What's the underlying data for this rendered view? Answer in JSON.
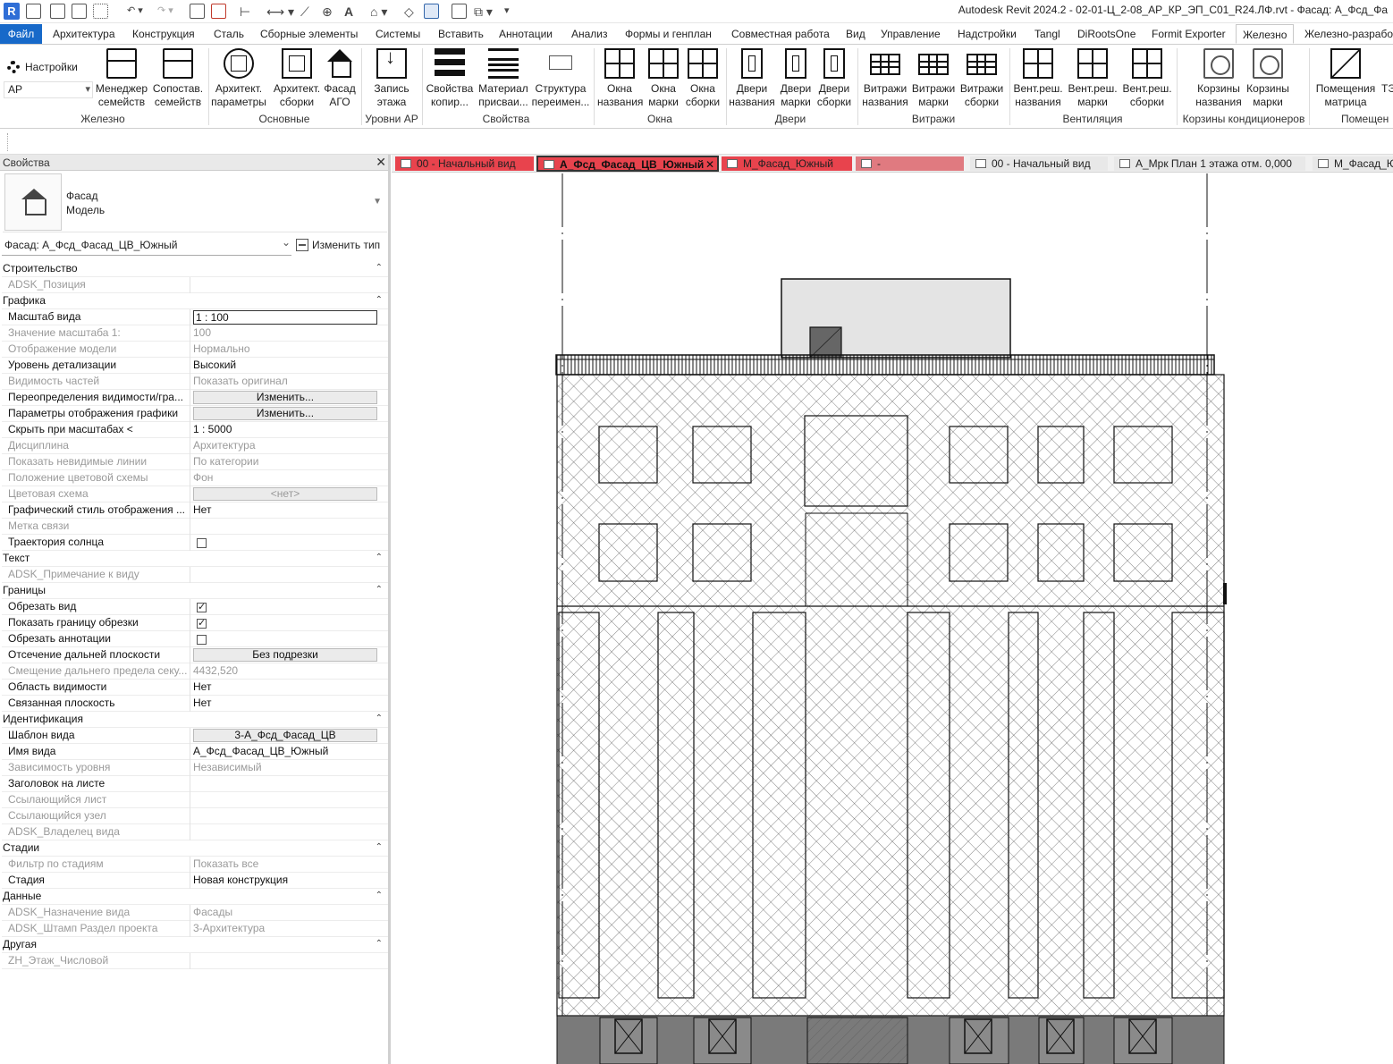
{
  "app": {
    "logo": "R",
    "title": "Autodesk Revit 2024.2 - 02-01-Ц_2-08_АР_КР_ЭП_С01_R24.ЛФ.rvt - Фасад: А_Фсд_Фа"
  },
  "ribbon_tabs": [
    {
      "label": "Файл"
    },
    {
      "label": "Архитектура"
    },
    {
      "label": "Конструкция"
    },
    {
      "label": "Сталь"
    },
    {
      "label": "Сборные элементы"
    },
    {
      "label": "Системы"
    },
    {
      "label": "Вставить"
    },
    {
      "label": "Аннотации"
    },
    {
      "label": "Анализ"
    },
    {
      "label": "Формы и генплан"
    },
    {
      "label": "Совместная работа"
    },
    {
      "label": "Вид"
    },
    {
      "label": "Управление"
    },
    {
      "label": "Надстройки"
    },
    {
      "label": "Tangl"
    },
    {
      "label": "DiRootsOne"
    },
    {
      "label": "Formit Exporter"
    },
    {
      "label": "Железно"
    },
    {
      "label": "Железно-разрабо"
    }
  ],
  "ribbon": {
    "settings_label": "Настройки",
    "ap_select": "АР",
    "buttons": {
      "manager_families": "Менеджер\nсемейств",
      "compare_families": "Сопостав.\nсемейств",
      "arch_params": "Архитект.\nпараметры",
      "arch_assembly": "Архитект.\nсборки",
      "facade_ago": "Фасад\nАГО",
      "floor_record": "Запись\nэтажа",
      "props_copy": "Свойства\nкопир...",
      "material_assign": "Материал\nприсваи...",
      "structure_rename": "Структура\nпереимен...",
      "windows_names": "Окна\nназвания",
      "windows_marks": "Окна\nмарки",
      "windows_assembly": "Окна\nсборки",
      "doors_names": "Двери\nназвания",
      "doors_marks": "Двери\nмарки",
      "doors_assembly": "Двери\nсборки",
      "curtain_names": "Витражи\nназвания",
      "curtain_marks": "Витражи\nмарки",
      "curtain_assembly": "Витражи\nсборки",
      "vent_names": "Вент.реш.\nназвания",
      "vent_marks": "Вент.реш.\nмарки",
      "vent_assembly": "Вент.реш.\nсборки",
      "baskets_names": "Корзины\nназвания",
      "baskets_marks": "Корзины\nмарки",
      "rooms_matrix": "Помещения\nматрица",
      "te": "ТЭ"
    },
    "panels": {
      "zhelezno": "Железно",
      "basic": "Основные",
      "levels": "Уровни АР",
      "properties": "Свойства",
      "windows": "Окна",
      "doors": "Двери",
      "curtains": "Витражи",
      "ventilation": "Вентиляция",
      "ac_baskets": "Корзины кондиционеров",
      "rooms": "Помещен"
    }
  },
  "properties": {
    "header": "Свойства",
    "type_name_line1": "Фасад",
    "type_name_line2": "Модель",
    "instance_selector": "Фасад: А_Фсд_Фасад_ЦВ_Южный",
    "edit_type_label": "Изменить тип",
    "rows": [
      {
        "kind": "group",
        "name": "Строительство"
      },
      {
        "kind": "ro",
        "name": "ADSK_Позиция",
        "value": ""
      },
      {
        "kind": "group",
        "name": "Графика"
      },
      {
        "kind": "input",
        "name": "Масштаб вида",
        "value": "1 : 100"
      },
      {
        "kind": "ro",
        "name": "Значение масштаба    1:",
        "value": "100"
      },
      {
        "kind": "ro",
        "name": "Отображение модели",
        "value": "Нормально"
      },
      {
        "kind": "text",
        "name": "Уровень детализации",
        "value": "Высокий"
      },
      {
        "kind": "ro",
        "name": "Видимость частей",
        "value": "Показать оригинал"
      },
      {
        "kind": "btn",
        "name": "Переопределения видимости/гра...",
        "value": "Изменить..."
      },
      {
        "kind": "btn",
        "name": "Параметры отображения графики",
        "value": "Изменить..."
      },
      {
        "kind": "text",
        "name": "Скрыть при масштабах <",
        "value": "1 : 5000"
      },
      {
        "kind": "ro",
        "name": "Дисциплина",
        "value": "Архитектура"
      },
      {
        "kind": "ro",
        "name": "Показать невидимые линии",
        "value": "По категории"
      },
      {
        "kind": "ro",
        "name": "Положение цветовой схемы",
        "value": "Фон"
      },
      {
        "kind": "robtn",
        "name": "Цветовая схема",
        "value": "<нет>"
      },
      {
        "kind": "text",
        "name": "Графический стиль отображения ...",
        "value": "Нет"
      },
      {
        "kind": "ro",
        "name": "Метка связи",
        "value": ""
      },
      {
        "kind": "check",
        "name": "Траектория солнца",
        "checked": false
      },
      {
        "kind": "group",
        "name": "Текст"
      },
      {
        "kind": "ro",
        "name": "ADSK_Примечание к виду",
        "value": ""
      },
      {
        "kind": "group",
        "name": "Границы"
      },
      {
        "kind": "check",
        "name": "Обрезать вид",
        "checked": true
      },
      {
        "kind": "check",
        "name": "Показать границу обрезки",
        "checked": true
      },
      {
        "kind": "check",
        "name": "Обрезать аннотации",
        "checked": false
      },
      {
        "kind": "btn",
        "name": "Отсечение дальней плоскости",
        "value": "Без подрезки"
      },
      {
        "kind": "ro",
        "name": "Смещение дальнего предела секу...",
        "value": "4432,520"
      },
      {
        "kind": "text",
        "name": "Область видимости",
        "value": "Нет"
      },
      {
        "kind": "text",
        "name": "Связанная плоскость",
        "value": "Нет"
      },
      {
        "kind": "group",
        "name": "Идентификация"
      },
      {
        "kind": "btn",
        "name": "Шаблон вида",
        "value": "3-А_Фсд_Фасад_ЦВ"
      },
      {
        "kind": "text",
        "name": "Имя вида",
        "value": "А_Фсд_Фасад_ЦВ_Южный"
      },
      {
        "kind": "ro",
        "name": "Зависимость уровня",
        "value": "Независимый"
      },
      {
        "kind": "text",
        "name": "Заголовок на листе",
        "value": ""
      },
      {
        "kind": "ro",
        "name": "Ссылающийся лист",
        "value": ""
      },
      {
        "kind": "ro",
        "name": "Ссылающийся узел",
        "value": ""
      },
      {
        "kind": "ro",
        "name": "ADSK_Владелец вида",
        "value": ""
      },
      {
        "kind": "group",
        "name": "Стадии"
      },
      {
        "kind": "ro",
        "name": "Фильтр по стадиям",
        "value": "Показать все"
      },
      {
        "kind": "text",
        "name": "Стадия",
        "value": "Новая конструкция"
      },
      {
        "kind": "group",
        "name": "Данные"
      },
      {
        "kind": "ro",
        "name": "ADSK_Назначение вида",
        "value": "Фасады"
      },
      {
        "kind": "ro",
        "name": "ADSK_Штамп Раздел проекта",
        "value": "3-Архитектура"
      },
      {
        "kind": "group",
        "name": "Другая"
      },
      {
        "kind": "ro",
        "name": "ZH_Этаж_Числовой",
        "value": ""
      }
    ]
  },
  "view_tabs": [
    {
      "label": "00 - Начальный вид",
      "style": "red"
    },
    {
      "label": "А_Фсд_Фасад_ЦВ_Южный",
      "style": "active"
    },
    {
      "label": "М_Фасад_Южный",
      "style": "red"
    },
    {
      "label": "-",
      "style": "red2"
    },
    {
      "label": "00 - Начальный вид",
      "style": "plain"
    },
    {
      "label": "А_Мрк План 1 этажа отм. 0,000",
      "style": "plain"
    },
    {
      "label": "М_Фасад_Ю",
      "style": "plain"
    }
  ],
  "colors": {
    "file_tab": "#1769c9",
    "view_tab_red": "#e8434d",
    "drawing_line": "#111111",
    "drawing_fill_dark": "#7a7a7a",
    "penthouse_fill": "#e4e4e4"
  }
}
